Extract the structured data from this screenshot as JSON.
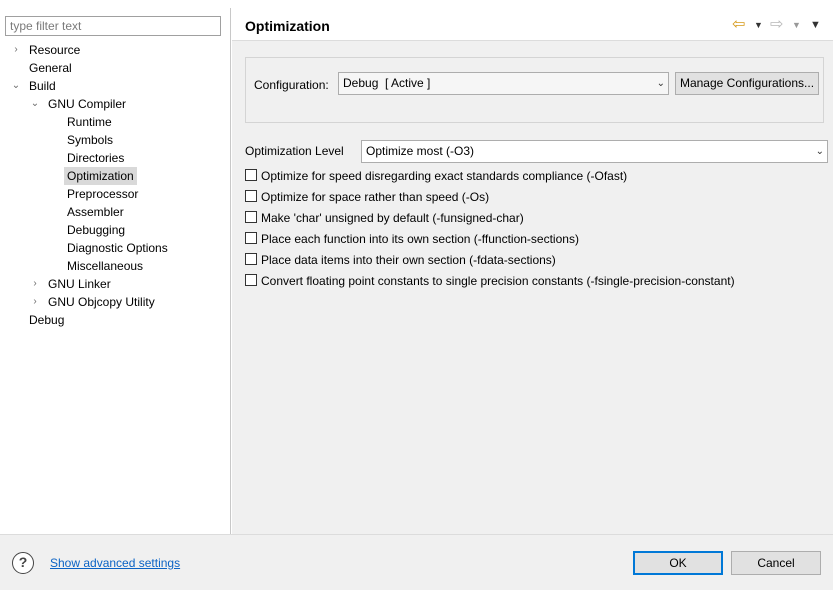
{
  "filter": {
    "placeholder": "type filter text"
  },
  "tree": {
    "resource": "Resource",
    "general": "General",
    "build": "Build",
    "gnu_compiler": "GNU Compiler",
    "runtime": "Runtime",
    "symbols": "Symbols",
    "directories": "Directories",
    "optimization": "Optimization",
    "preprocessor": "Preprocessor",
    "assembler": "Assembler",
    "debugging": "Debugging",
    "diagnostic_options": "Diagnostic Options",
    "miscellaneous": "Miscellaneous",
    "gnu_linker": "GNU Linker",
    "gnu_objcopy": "GNU Objcopy Utility",
    "debug": "Debug"
  },
  "header": {
    "title": "Optimization"
  },
  "configuration": {
    "label": "Configuration:",
    "value": "Debug  [ Active ]",
    "manage_button": "Manage Configurations..."
  },
  "optimization_level": {
    "label": "Optimization Level",
    "value": "Optimize most (-O3)"
  },
  "options": [
    "Optimize for speed disregarding exact standards compliance (-Ofast)",
    "Optimize for space rather than speed (-Os)",
    "Make 'char' unsigned by default (-funsigned-char)",
    "Place each function into its own section (-ffunction-sections)",
    "Place data items into their own section (-fdata-sections)",
    "Convert floating point constants to single precision constants (-fsingle-precision-constant)"
  ],
  "footer": {
    "advanced_link": "Show advanced settings",
    "ok": "OK",
    "cancel": "Cancel"
  }
}
